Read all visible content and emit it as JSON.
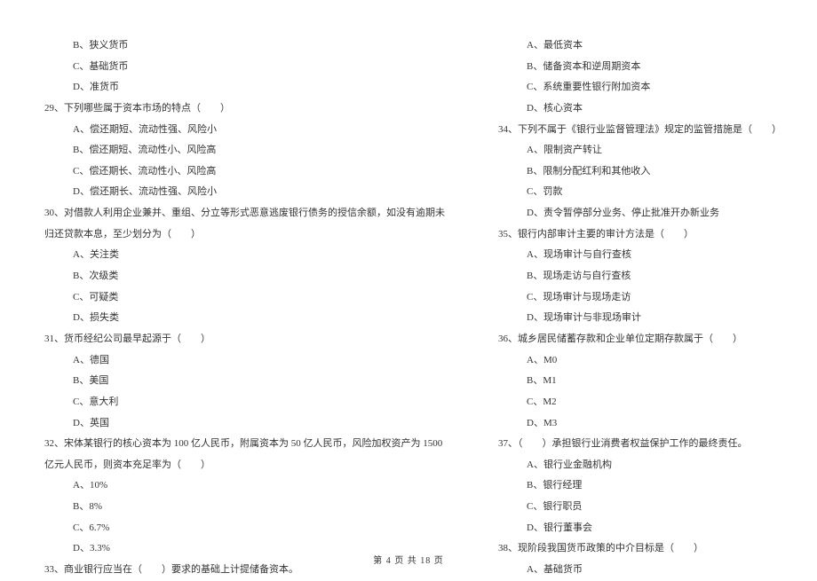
{
  "col1": {
    "pre_opts": [
      "B、狭义货币",
      "C、基础货币",
      "D、准货币"
    ],
    "q29": {
      "stem": "29、下列哪些属于资本市场的特点（　　）",
      "opts": [
        "A、偿还期短、流动性强、风险小",
        "B、偿还期短、流动性小、风险高",
        "C、偿还期长、流动性小、风险高",
        "D、偿还期长、流动性强、风险小"
      ]
    },
    "q30": {
      "stem1": "30、对借款人利用企业兼并、重组、分立等形式恶意逃废银行债务的授信余额，如没有逾期未",
      "stem2": "归还贷款本息，至少划分为（　　）",
      "opts": [
        "A、关注类",
        "B、次级类",
        "C、可疑类",
        "D、损失类"
      ]
    },
    "q31": {
      "stem": "31、货币经纪公司最早起源于（　　）",
      "opts": [
        "A、德国",
        "B、美国",
        "C、意大利",
        "D、英国"
      ]
    },
    "q32": {
      "stem1": "32、宋体某银行的核心资本为 100 亿人民币，附属资本为 50 亿人民币，风险加权资产为 1500",
      "stem2": "亿元人民币，则资本充足率为（　　）",
      "opts": [
        "A、10%",
        "B、8%",
        "C、6.7%",
        "D、3.3%"
      ]
    },
    "q33": {
      "stem": "33、商业银行应当在（　　）要求的基础上计提储备资本。"
    }
  },
  "col2": {
    "q33_opts": [
      "A、最低资本",
      "B、储备资本和逆周期资本",
      "C、系统重要性银行附加资本",
      "D、核心资本"
    ],
    "q34": {
      "stem": "34、下列不属于《银行业监督管理法》规定的监管措施是（　　）",
      "opts": [
        "A、限制资产转让",
        "B、限制分配红利和其他收入",
        "C、罚款",
        "D、责令暂停部分业务、停止批准开办新业务"
      ]
    },
    "q35": {
      "stem": "35、银行内部审计主要的审计方法是（　　）",
      "opts": [
        "A、现场审计与自行查核",
        "B、现场走访与自行查核",
        "C、现场审计与现场走访",
        "D、现场审计与非现场审计"
      ]
    },
    "q36": {
      "stem": "36、城乡居民储蓄存款和企业单位定期存款属于（　　）",
      "opts": [
        "A、M0",
        "B、M1",
        "C、M2",
        "D、M3"
      ]
    },
    "q37": {
      "stem": "37、（　　）承担银行业消费者权益保护工作的最终责任。",
      "opts": [
        "A、银行业金融机构",
        "B、银行经理",
        "C、银行职员",
        "D、银行董事会"
      ]
    },
    "q38": {
      "stem": "38、现阶段我国货币政策的中介目标是（　　）",
      "opts": [
        "A、基础货币"
      ]
    }
  },
  "footer": "第 4 页 共 18 页"
}
